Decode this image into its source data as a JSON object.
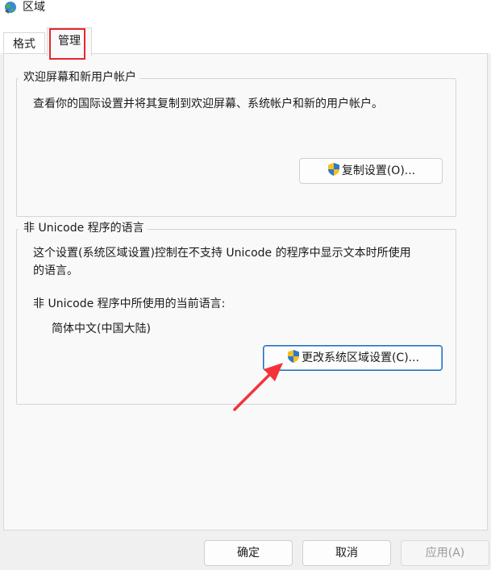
{
  "window": {
    "title": "区域",
    "icon": "globe-icon"
  },
  "tabs": [
    {
      "label": "格式",
      "active": false
    },
    {
      "label": "管理",
      "active": true
    }
  ],
  "welcome_group": {
    "legend": "欢迎屏幕和新用户帐户",
    "description": "查看你的国际设置并将其复制到欢迎屏幕、系统帐户和新的用户帐户。",
    "button_label": "复制设置(O)...",
    "button_icon": "uac-shield-icon"
  },
  "non_unicode_group": {
    "legend": "非 Unicode 程序的语言",
    "description_line1": "这个设置(系统区域设置)控制在不支持 Unicode 的程序中显示文本时所使用",
    "description_line2": "的语言。",
    "current_label": "非 Unicode 程序中所使用的当前语言:",
    "current_value": "简体中文(中国大陆)",
    "button_label": "更改系统区域设置(C)...",
    "button_icon": "uac-shield-icon"
  },
  "footer": {
    "ok_label": "确定",
    "cancel_label": "取消",
    "apply_label": "应用(A)"
  },
  "annotations": {
    "highlight_color": "#e8262c",
    "arrow_color": "#f2343a"
  }
}
